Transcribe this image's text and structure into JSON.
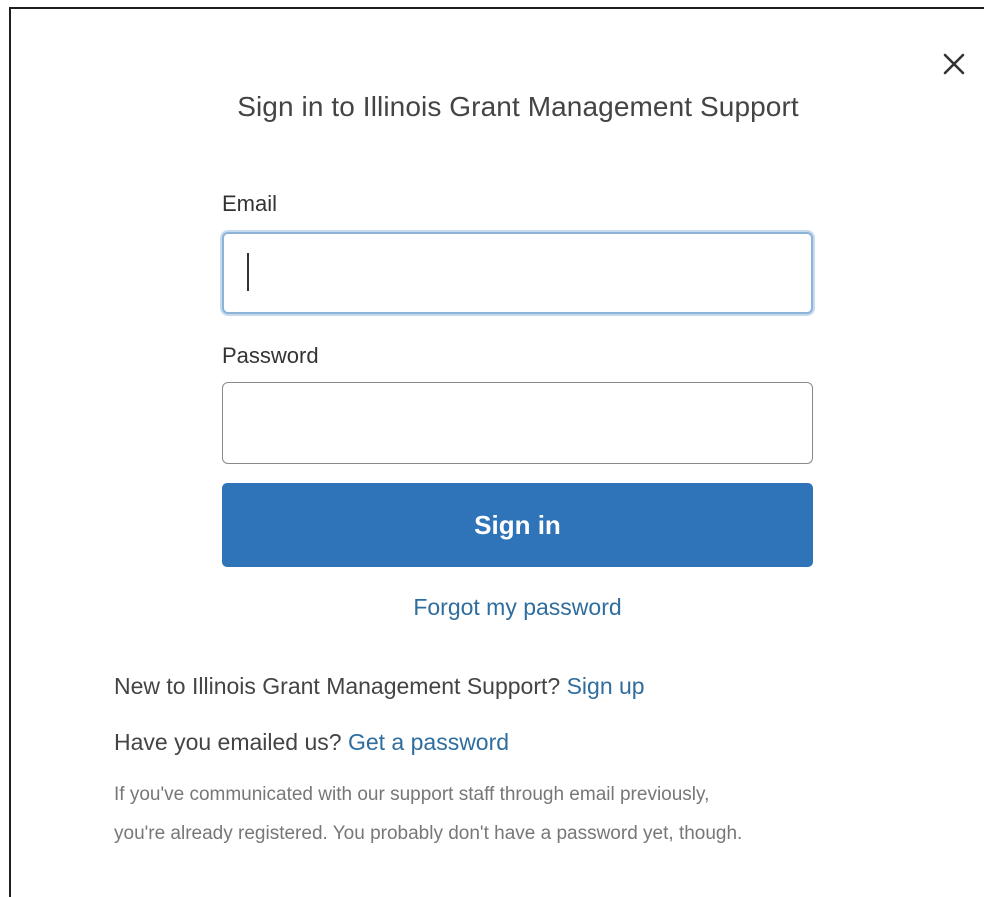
{
  "dialog": {
    "title": "Sign in to Illinois Grant Management Support",
    "close_icon": "close-icon"
  },
  "form": {
    "email_label": "Email",
    "email_value": "",
    "password_label": "Password",
    "password_value": "",
    "submit_label": "Sign in",
    "forgot_label": "Forgot my password"
  },
  "footer": {
    "new_text": "New to Illinois Grant Management Support?",
    "signup_label": "Sign up",
    "emailed_text": "Have you emailed us?",
    "get_password_label": "Get a password",
    "help_line1": "If you've communicated with our support staff through email previously,",
    "help_line2": "you're already registered. You probably don't have a password yet, though."
  },
  "colors": {
    "primary_button": "#2f74b8",
    "link": "#2f6d9e",
    "focus_border": "#8db3d8"
  }
}
